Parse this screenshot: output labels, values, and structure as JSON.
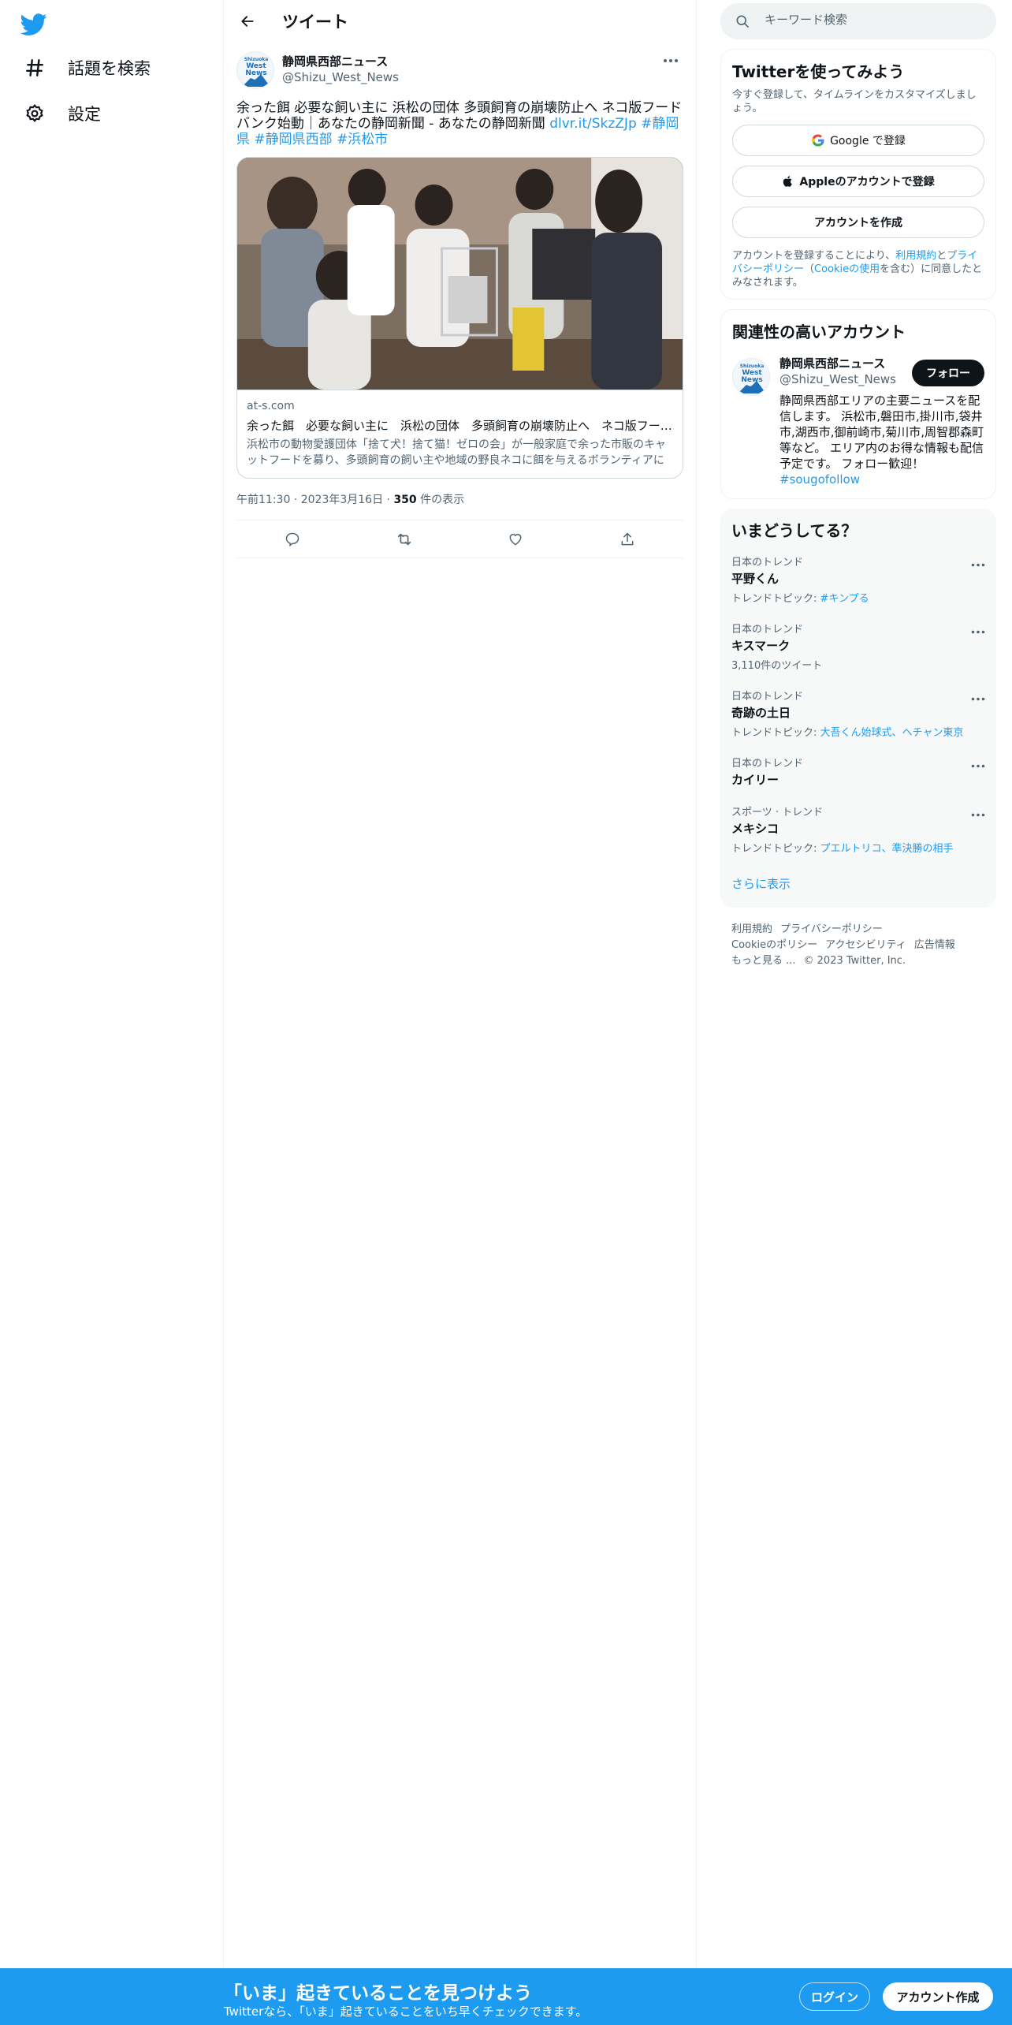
{
  "nav": {
    "items": [
      {
        "label": "話題を検索",
        "icon": "hashtag-icon"
      },
      {
        "label": "設定",
        "icon": "gear-icon"
      }
    ]
  },
  "main": {
    "title": "ツイート",
    "tweet": {
      "author_name": "静岡県西部ニュース",
      "author_handle": "@Shizu_West_News",
      "avatar_text": [
        "Shizuoka",
        "West",
        "News"
      ],
      "text": "余った餌 必要な飼い主に 浜松の団体 多頭飼育の崩壊防止へ ネコ版フードバンク始動｜あなたの静岡新聞 - あなたの静岡新聞 ",
      "link": "dlvr.it/SkzZJp",
      "hashtags": [
        "#静岡県",
        "#静岡県西部",
        "#浜松市"
      ],
      "card": {
        "domain": "at-s.com",
        "title": "余った餌　必要な飼い主に　浜松の団体　多頭飼育の崩壊防止へ　ネコ版フードバンク始動",
        "description": "浜松市の動物愛護団体「捨て犬！捨て猫！ゼロの会」が一般家庭で余った市販のキャットフードを募り、多頭飼育の飼い主や地域の野良ネコに餌を与えるボランティアに提供するフードバンクを始めた。"
      },
      "time": "午前11:30",
      "date": "2023年3月16日",
      "views_count": "350",
      "views_label": "件の表示"
    }
  },
  "right": {
    "search_placeholder": "キーワード検索",
    "signup_panel": {
      "title": "Twitterを使ってみよう",
      "subtitle": "今すぐ登録して、タイムラインをカスタマイズしましょう。",
      "google": "Google で登録",
      "apple": "Appleのアカウントで登録",
      "create": "アカウントを作成",
      "fine_1": "アカウントを登録することにより、",
      "fine_terms": "利用規約",
      "fine_2": "と",
      "fine_privacy": "プライバシーポリシー",
      "fine_3": "（",
      "fine_cookie": "Cookieの使用",
      "fine_4": "を含む）に同意したとみなされます。"
    },
    "related": {
      "title": "関連性の高いアカウント",
      "name": "静岡県西部ニュース",
      "handle": "@Shizu_West_News",
      "follow": "フォロー",
      "bio": "静岡県西部エリアの主要ニュースを配信します。 浜松市,磐田市,掛川市,袋井市,湖西市,御前崎市,菊川市,周智郡森町等など。 エリア内のお得な情報も配信予定です。 フォロー歓迎！",
      "bio_tag": "#sougofollow"
    },
    "trends": {
      "title": "いまどうしてる？",
      "items": [
        {
          "category": "日本のトレンド",
          "name": "平野くん",
          "sub_prefix": "トレンドトピック: ",
          "sub_link": "#キンプる"
        },
        {
          "category": "日本のトレンド",
          "name": "キスマーク",
          "sub_prefix": "3,110件のツイート",
          "sub_link": ""
        },
        {
          "category": "日本のトレンド",
          "name": "奇跡の土日",
          "sub_prefix": "トレンドトピック: ",
          "sub_link": "大吾くん始球式、ヘチャン東京"
        },
        {
          "category": "日本のトレンド",
          "name": "カイリー",
          "sub_prefix": "",
          "sub_link": ""
        },
        {
          "category": "スポーツ · トレンド",
          "name": "メキシコ",
          "sub_prefix": "トレンドトピック: ",
          "sub_link": "プエルトリコ、準決勝の相手"
        }
      ],
      "show_more": "さらに表示"
    },
    "footer": {
      "links": [
        "利用規約",
        "プライバシーポリシー",
        "Cookieのポリシー",
        "アクセシビリティ",
        "広告情報",
        "もっと見る ..."
      ],
      "copyright": "© 2023 Twitter, Inc."
    }
  },
  "bottom": {
    "title": "「いま」起きていることを見つけよう",
    "subtitle": "Twitterなら、「いま」起きていることをいち早くチェックできます。",
    "login": "ログイン",
    "signup": "アカウント作成"
  },
  "colors": {
    "accent": "#1d9bf0",
    "text": "#0f1419",
    "muted": "#536471"
  }
}
